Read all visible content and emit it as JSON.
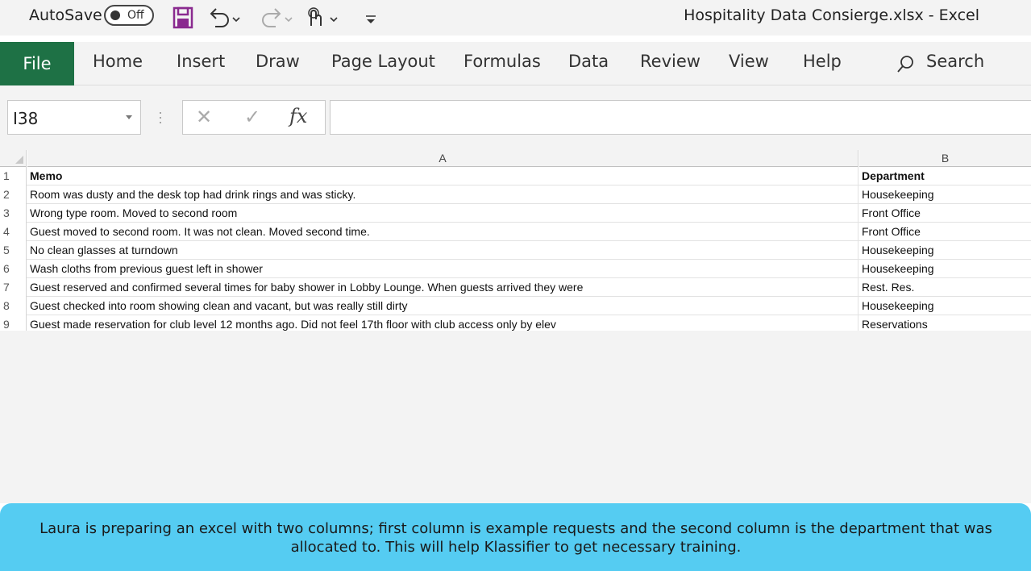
{
  "titlebar": {
    "autosave_label": "AutoSave",
    "autosave_state": "Off",
    "document_title": "Hospitality Data Consierge.xlsx  -  Excel"
  },
  "ribbon": {
    "tabs": [
      "File",
      "Home",
      "Insert",
      "Draw",
      "Page Layout",
      "Formulas",
      "Data",
      "Review",
      "View",
      "Help"
    ],
    "search_label": "Search",
    "accent": "#1e7145"
  },
  "formula_bar": {
    "name_box": "I38",
    "formula": ""
  },
  "sheet": {
    "columns": [
      "A",
      "B"
    ],
    "rows": [
      {
        "num": "1",
        "a": "Memo",
        "b": "Department"
      },
      {
        "num": "2",
        "a": "Room was dusty and the desk top had drink rings and was sticky.",
        "b": "Housekeeping"
      },
      {
        "num": "3",
        "a": "Wrong type room. Moved to second room",
        "b": "Front Office"
      },
      {
        "num": "4",
        "a": "Guest moved to second room.  It was not clean.  Moved second time.",
        "b": "Front Office"
      },
      {
        "num": "5",
        "a": "No clean glasses at turndown",
        "b": "Housekeeping"
      },
      {
        "num": "6",
        "a": "Wash cloths from previous guest left in shower",
        "b": "Housekeeping"
      },
      {
        "num": "7",
        "a": "Guest reserved and confirmed several times for baby shower in Lobby Lounge.  When guests arrived they were",
        "b": "Rest. Res."
      },
      {
        "num": "8",
        "a": "Guest checked into room showing clean and vacant, but was really still dirty",
        "b": "Housekeeping"
      },
      {
        "num": "9",
        "a": "Guest made reservation for club level 12 months ago.  Did not feel 17th floor with club access only by elev",
        "b": "Reservations"
      }
    ]
  },
  "caption": {
    "text": "Laura is preparing an excel with two columns; first column is example requests and the second column is the department that was allocated to. This will help Klassifier to get necessary training.",
    "color": "#55ccf2"
  }
}
